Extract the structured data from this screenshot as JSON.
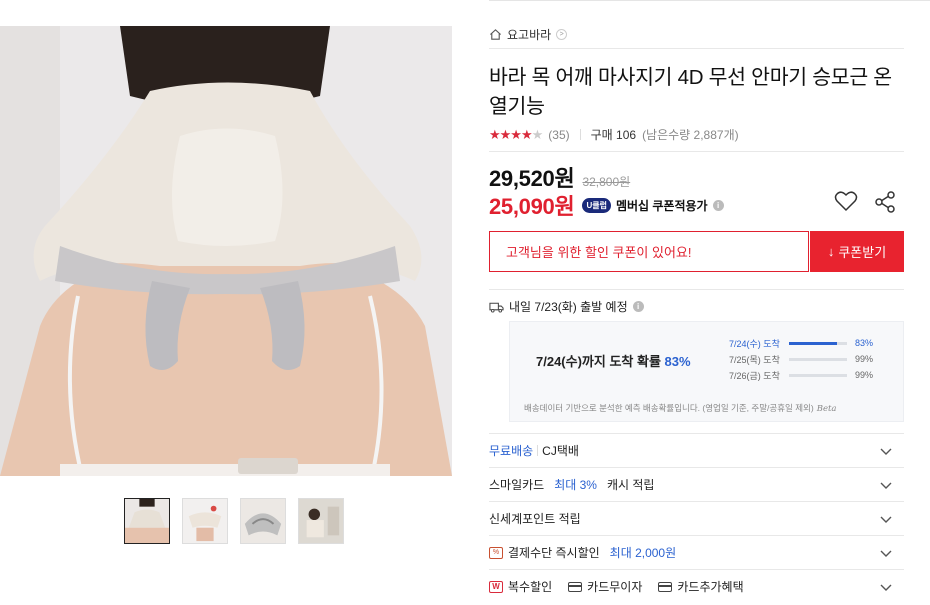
{
  "gallery": {
    "thumb_count": 4,
    "active_index": 0
  },
  "store": {
    "name": "요고바라",
    "chev": ">"
  },
  "product": {
    "title": "바라 목 어깨 마사지기 4D 무선 안마기 승모근 온열기능",
    "rating_value": 4,
    "rating_max": 5,
    "review_count": "(35)",
    "purchase": "구매 106",
    "stock": "(남은수량 2,887개)"
  },
  "price": {
    "sale": "29,520원",
    "original": "32,800원",
    "coupon": "25,090원",
    "club_badge": "U클럽",
    "coupon_label": "멤버십 쿠폰적용가",
    "info": "i"
  },
  "coupon": {
    "message": "고객님을 위한 할인 쿠폰이 있어요!",
    "button": "쿠폰받기",
    "button_icon": "↓"
  },
  "shipping": {
    "dispatch": "내일 7/23(화) 출발 예정",
    "info": "i",
    "predict_prefix": "7/24(수)까지 도착 확률",
    "predict_pct": "83%",
    "rows": [
      {
        "date": "7/24(수) 도착",
        "pct": "83%",
        "value": 83,
        "highlight": true
      },
      {
        "date": "7/25(목) 도착",
        "pct": "99%",
        "value": 99,
        "highlight": false
      },
      {
        "date": "7/26(금) 도착",
        "pct": "99%",
        "value": 99,
        "highlight": false
      }
    ],
    "note": "배송데이터 기반으로 분석한 예측 배송확률입니다. (영업일 기준, 주말/공휴일 제외)",
    "beta": "Beta"
  },
  "benefits": {
    "free_ship": "무료배송",
    "courier": "CJ택배",
    "smile_prefix": "스마일카드",
    "smile_highlight": "최대 3%",
    "smile_suffix": "캐시 적립",
    "ssg": "신세계포인트 적립",
    "pay_prefix": "결제수단 즉시할인",
    "pay_highlight": "최대 2,000원",
    "pay_icon": "%",
    "multi": "복수할인",
    "multi_icon": "W",
    "interest": "카드무이자",
    "card_benefit": "카드추가혜택"
  },
  "colors": {
    "accent_red": "#e0202f",
    "accent_blue": "#2b62d0",
    "star": "#d92b3c"
  }
}
